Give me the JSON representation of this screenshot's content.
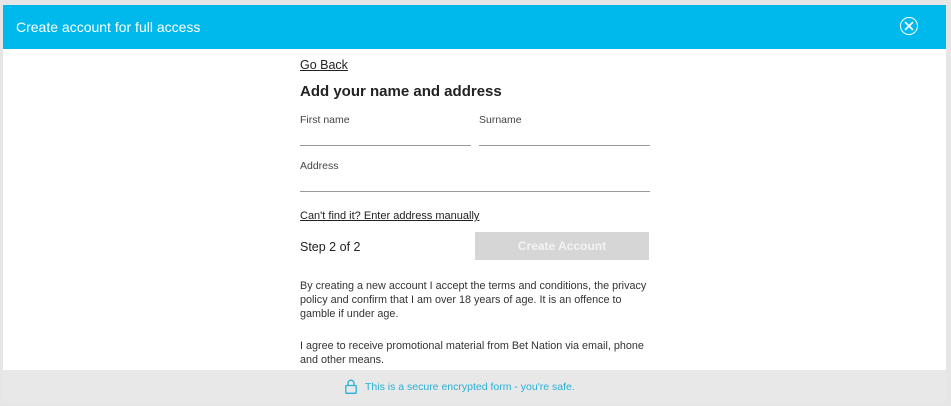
{
  "header": {
    "title": "Create account for full access",
    "close_icon": "close-circle-icon"
  },
  "form": {
    "go_back": "Go Back",
    "title": "Add your name and address",
    "first_name": {
      "label": "First name",
      "value": ""
    },
    "surname": {
      "label": "Surname",
      "value": ""
    },
    "address": {
      "label": "Address",
      "value": ""
    },
    "manual_link": "Can't find it? Enter address manually",
    "step": "Step 2 of 2",
    "create_button": "Create Account",
    "terms_text": "By creating a new account I accept the terms and conditions, the privacy policy and confirm that I am over 18 years of age. It is an offence to gamble if under age.",
    "promo_text": "I agree to receive promotional material from Bet Nation via email, phone and other means."
  },
  "footer": {
    "secure_text": "This is a secure encrypted form - you're safe.",
    "lock_icon": "lock-icon"
  },
  "colors": {
    "accent": "#00b9ec",
    "secure_text": "#2ab0d6",
    "disabled_button": "#d6d6d6"
  }
}
